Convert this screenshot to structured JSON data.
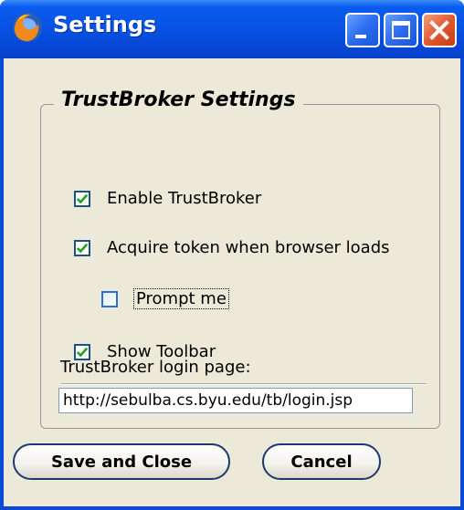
{
  "window": {
    "title": "Settings",
    "app_icon": "firefox-icon",
    "controls": {
      "minimize": "minimize-icon",
      "maximize": "maximize-icon",
      "close": "close-icon"
    }
  },
  "group": {
    "legend": "TrustBroker Settings"
  },
  "options": [
    {
      "label": "Enable TrustBroker",
      "checked": true
    },
    {
      "label": "Acquire token when browser loads",
      "checked": true
    },
    {
      "label": "Prompt me",
      "checked": false
    },
    {
      "label": "Show Toolbar",
      "checked": true
    }
  ],
  "login": {
    "label": "TrustBroker login page:",
    "value": "http://sebulba.cs.byu.edu/tb/login.jsp"
  },
  "buttons": {
    "save": "Save and Close",
    "cancel": "Cancel"
  },
  "colors": {
    "titlebar": "#0a5cee",
    "client_bg": "#ece9d8",
    "checkmark": "#21a121"
  }
}
